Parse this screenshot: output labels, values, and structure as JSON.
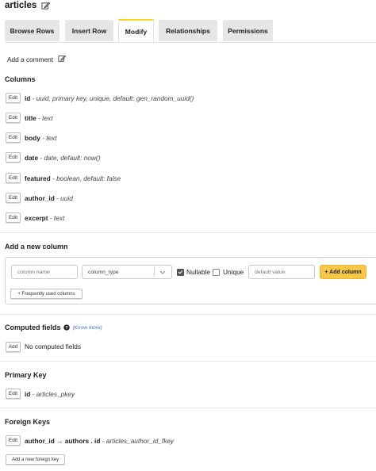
{
  "table": {
    "name": "articles"
  },
  "tabs": [
    {
      "label": "Browse Rows"
    },
    {
      "label": "Insert Row"
    },
    {
      "label": "Modify"
    },
    {
      "label": "Relationships"
    },
    {
      "label": "Permissions"
    }
  ],
  "comment": {
    "label": "Add a comment"
  },
  "columns": {
    "title": "Columns",
    "edit_label": "Edit",
    "items": [
      {
        "name": "id",
        "desc": " - uuid, primary key, unique, default: gen_random_uuid()"
      },
      {
        "name": "title",
        "desc": " - text"
      },
      {
        "name": "body",
        "desc": " - text"
      },
      {
        "name": "date",
        "desc": " - date, default: now()"
      },
      {
        "name": "featured",
        "desc": " - boolean, default: false"
      },
      {
        "name": "author_id",
        "desc": " - uuid"
      },
      {
        "name": "excerpt",
        "desc": " - text"
      }
    ]
  },
  "add_column": {
    "title": "Add a new column",
    "name_placeholder": "column name",
    "type_value": "column_type",
    "nullable_label": "Nullable",
    "nullable_checked": true,
    "unique_label": "Unique",
    "unique_checked": false,
    "default_placeholder": "default value",
    "add_button": "+ Add column",
    "frequent_button": "+ Frequently used columns"
  },
  "computed": {
    "title": "Computed fields",
    "know_more": "(Know more)",
    "add_label": "Add",
    "empty_text": "No computed fields"
  },
  "primary_key": {
    "title": "Primary Key",
    "edit_label": "Edit",
    "column": "id",
    "desc": " - articles_pkey"
  },
  "foreign_keys": {
    "title": "Foreign Keys",
    "edit_label": "Edit",
    "relation": "author_id → authors . id",
    "desc": " - articles_author_id_fkey",
    "add_button": "Add a new foreign key"
  },
  "colors": {
    "accent_yellow": "#f7c845",
    "tab_active_border": "#f8d721",
    "link_blue": "#3b6dd8"
  }
}
